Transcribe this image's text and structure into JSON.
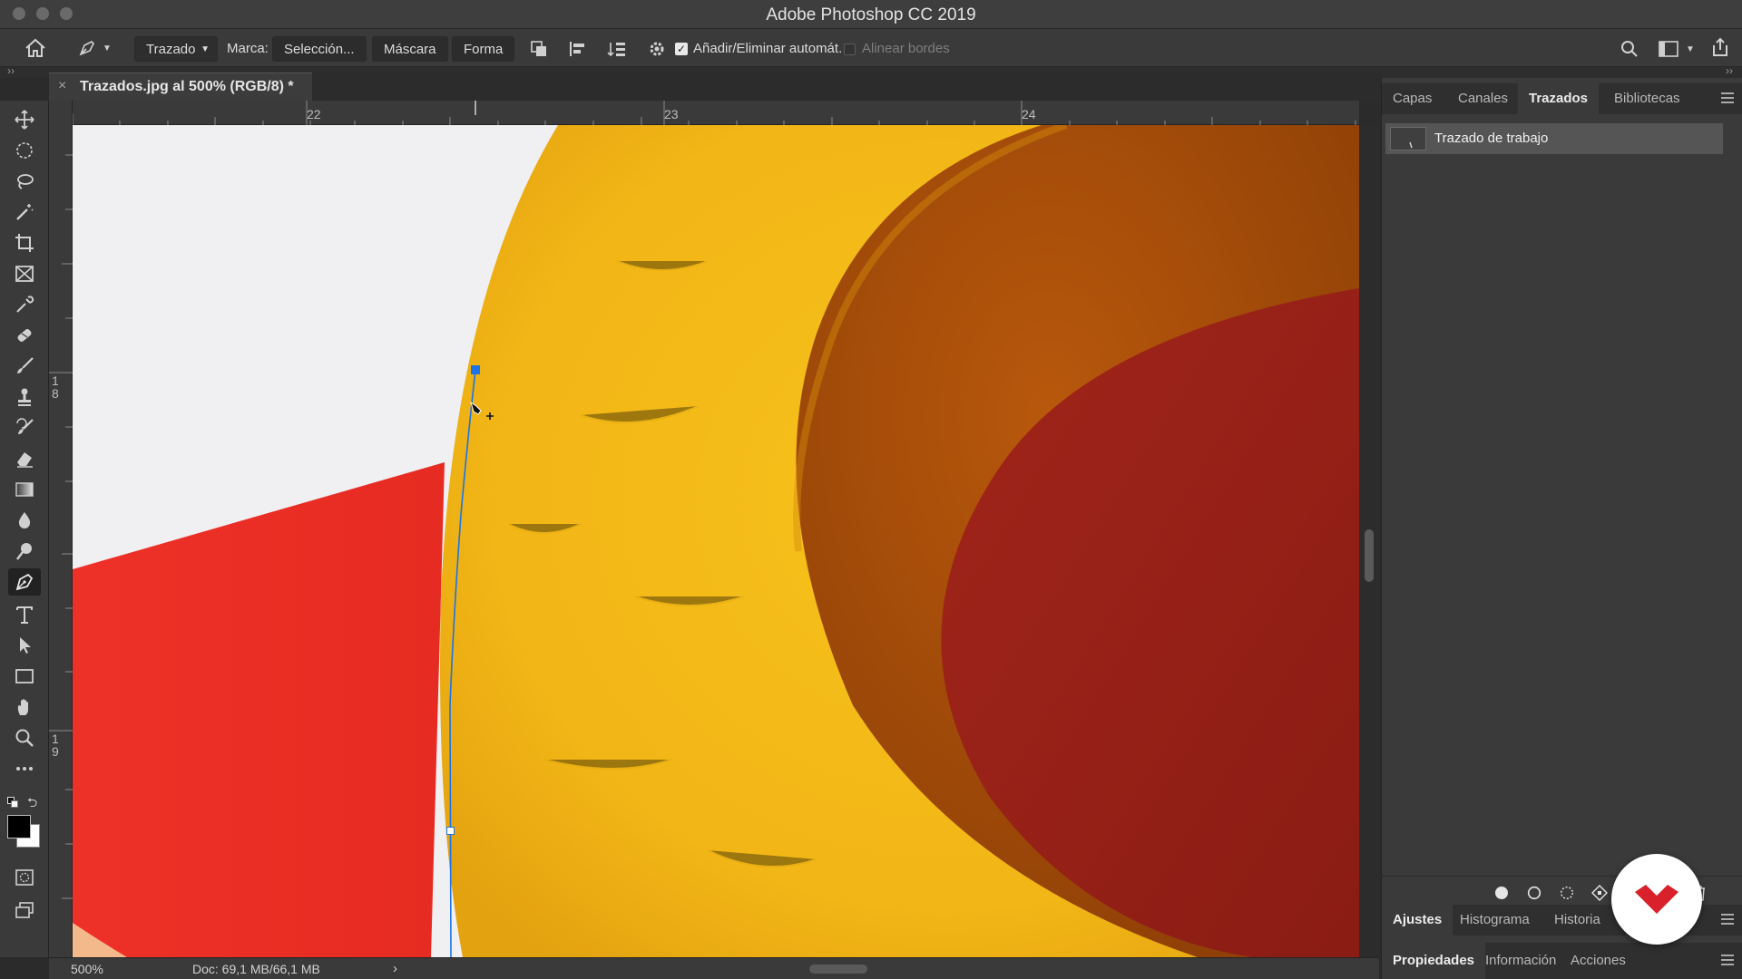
{
  "window": {
    "title": "Adobe Photoshop CC 2019"
  },
  "options_bar": {
    "mode_select": "Trazado",
    "mark_label": "Marca:",
    "selection_button": "Selección...",
    "mask_button": "Máscara",
    "shape_button": "Forma",
    "auto_add_delete_label": "Añadir/Eliminar automát.",
    "auto_add_delete_checked": true,
    "align_edges_label": "Alinear bordes",
    "align_edges_checked": false
  },
  "document": {
    "tab_title": "Trazados.jpg al 500% (RGB/8) *",
    "zoom": "500%",
    "doc_size": "Doc: 69,1 MB/66,1 MB"
  },
  "rulers": {
    "top_labels": [
      "22",
      "23",
      "24"
    ],
    "left_labels": [
      "1\n8",
      "1\n9"
    ]
  },
  "tools": {
    "active": "pen-tool",
    "items": [
      "move",
      "elliptical-marquee",
      "lasso",
      "magic-wand",
      "crop",
      "frame",
      "eyedropper",
      "healing-brush",
      "brush",
      "clone-stamp",
      "history-brush",
      "eraser",
      "gradient",
      "blur",
      "dodge",
      "pen",
      "type",
      "path-selection",
      "rectangle",
      "hand",
      "zoom",
      "more"
    ]
  },
  "panels": {
    "top_tabs": [
      "Capas",
      "Canales",
      "Trazados",
      "Bibliotecas"
    ],
    "top_active": "Trazados",
    "paths": [
      {
        "name": "Trazado de trabajo"
      }
    ],
    "bottom_tabs_1": [
      "Ajustes",
      "Histograma",
      "Historia"
    ],
    "bottom_active_1": "Ajustes",
    "bottom_tabs_2": [
      "Propiedades",
      "Información",
      "Acciones"
    ],
    "bottom_active_2": "Propiedades"
  },
  "colors": {
    "accent_path": "#1a73e8",
    "logo": "#d8212b"
  }
}
